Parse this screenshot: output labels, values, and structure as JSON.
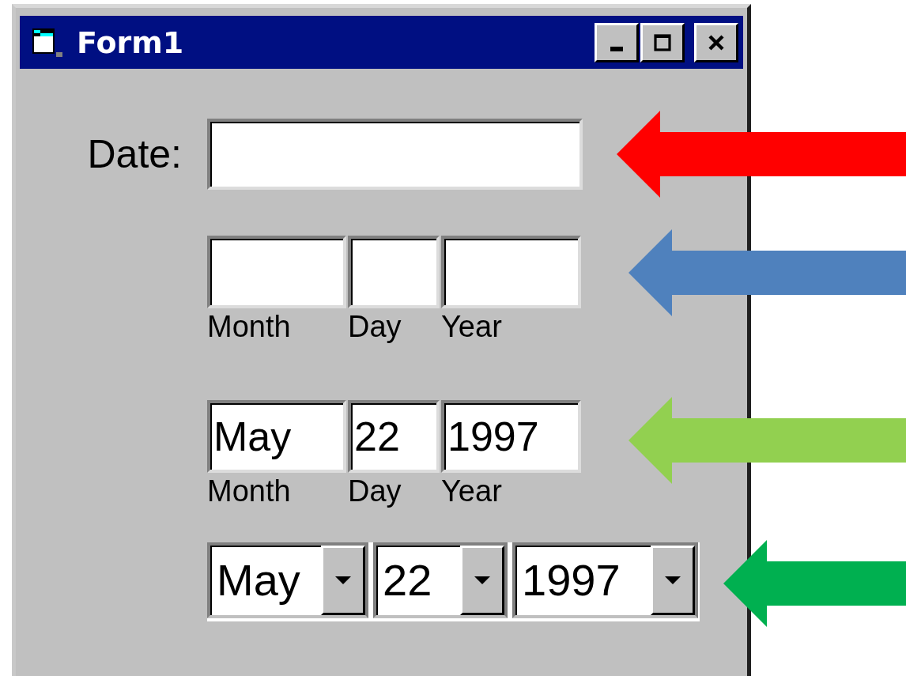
{
  "window": {
    "title": "Form1"
  },
  "date_field": {
    "label": "Date:"
  },
  "empty_fields": [
    {
      "caption": "Month"
    },
    {
      "caption": "Day"
    },
    {
      "caption": "Year"
    }
  ],
  "filled_fields": [
    {
      "value": "May",
      "caption": "Month"
    },
    {
      "value": "22",
      "caption": "Day"
    },
    {
      "value": "1997",
      "caption": "Year"
    }
  ],
  "dropdowns": [
    {
      "value": "May"
    },
    {
      "value": "22"
    },
    {
      "value": "1997"
    }
  ],
  "arrows": [
    {
      "color": "#ff0000"
    },
    {
      "color": "#4f81bd"
    },
    {
      "color": "#92d050"
    },
    {
      "color": "#00b050"
    }
  ]
}
